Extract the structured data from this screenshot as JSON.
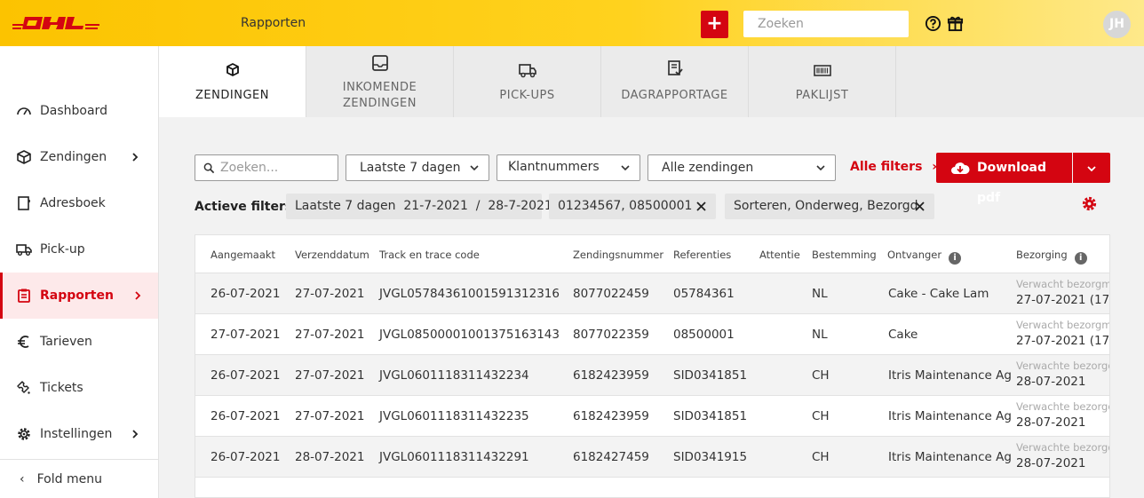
{
  "header": {
    "title": "Rapporten",
    "add_label": "+",
    "search_placeholder": "Zoeken",
    "avatar_initials": "JH"
  },
  "colors": {
    "brand_yellow": "#ffcc00",
    "brand_red": "#d40511"
  },
  "sidebar": {
    "items": [
      {
        "label": "Dashboard",
        "icon": "gauge-icon",
        "chevron": false
      },
      {
        "label": "Zendingen",
        "icon": "box-icon",
        "chevron": true
      },
      {
        "label": "Adresboek",
        "icon": "address-book-icon",
        "chevron": false
      },
      {
        "label": "Pick-up",
        "icon": "truck-icon",
        "chevron": false
      },
      {
        "label": "Rapporten",
        "icon": "report-icon",
        "chevron": true,
        "active": true
      },
      {
        "label": "Tarieven",
        "icon": "euro-icon",
        "chevron": false
      },
      {
        "label": "Tickets",
        "icon": "ticket-icon",
        "chevron": false
      },
      {
        "label": "Instellingen",
        "icon": "gear-icon",
        "chevron": true
      }
    ],
    "fold_label": "Fold menu"
  },
  "tabs": [
    {
      "line1": "ZENDINGEN",
      "line2": "",
      "icon": "box-icon",
      "active": true
    },
    {
      "line1": "INKOMENDE",
      "line2": "ZENDINGEN",
      "icon": "inbox-icon"
    },
    {
      "line1": "PICK-UPS",
      "line2": "",
      "icon": "truck-icon"
    },
    {
      "line1": "DAGRAPPORTAGE",
      "line2": "",
      "icon": "checklist-icon"
    },
    {
      "line1": "PAKLIJST",
      "line2": "",
      "icon": "barcode-icon"
    }
  ],
  "filters": {
    "search_placeholder": "Zoeken...",
    "period": "Laatste 7 dagen",
    "customer_numbers": "Klantnummers",
    "shipments": "Alle zendingen",
    "all_filters": "Alle filters",
    "download": "Download pdf",
    "active_label": "Actieve filters:",
    "chips": [
      "Laatste 7 dagen  21-7-2021  /  28-7-2021",
      "01234567, 08500001",
      "Sorteren, Onderweg, Bezorgd"
    ]
  },
  "table": {
    "columns": [
      "Aangemaakt",
      "Verzenddatum",
      "Track en trace code",
      "Zendingsnummer",
      "Referenties",
      "Attentie",
      "Bestemming",
      "Ontvanger",
      "Bezorging"
    ],
    "rows": [
      [
        "26-07-2021",
        "27-07-2021",
        "JVGL05784361001591312316",
        "8077022459",
        "05784361",
        "",
        "NL",
        "Cake - Cake Lam",
        "Verwacht bezorgm",
        "27-07-2021 (17"
      ],
      [
        "27-07-2021",
        "27-07-2021",
        "JVGL08500001001375163143",
        "8077022359",
        "08500001",
        "",
        "NL",
        "Cake",
        "Verwacht bezorgm",
        "27-07-2021 (17"
      ],
      [
        "26-07-2021",
        "27-07-2021",
        "JVGL0601118311432234",
        "6182423959",
        "SID0341851",
        "",
        "CH",
        "Itris Maintenance Ag",
        "Verwachte bezorgd",
        "28-07-2021"
      ],
      [
        "26-07-2021",
        "27-07-2021",
        "JVGL0601118311432235",
        "6182423959",
        "SID0341851",
        "",
        "CH",
        "Itris Maintenance Ag",
        "Verwachte bezorgd",
        "28-07-2021"
      ],
      [
        "26-07-2021",
        "28-07-2021",
        "JVGL0601118311432291",
        "6182427459",
        "SID0341915",
        "",
        "CH",
        "Itris Maintenance Ag",
        "Verwachte bezorgd",
        "28-07-2021"
      ]
    ]
  }
}
